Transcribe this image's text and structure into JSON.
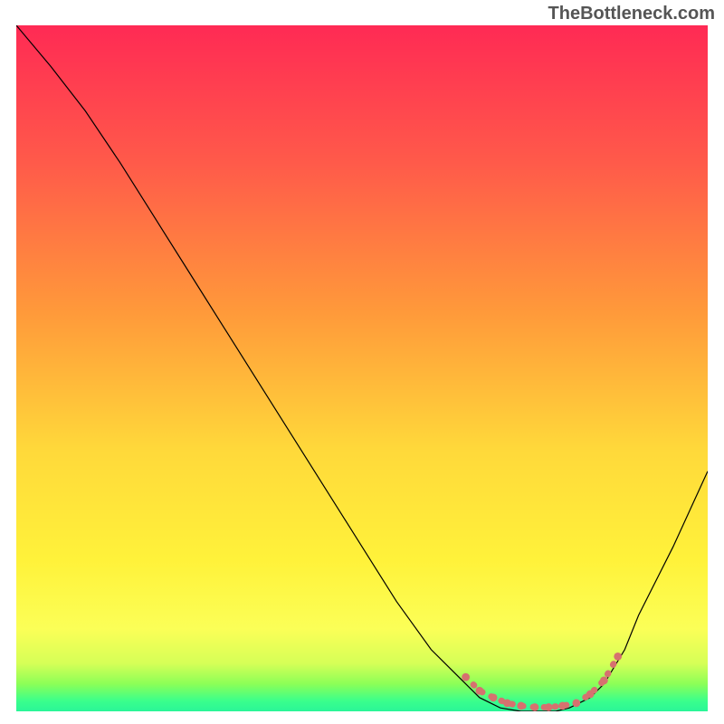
{
  "watermark": "TheBottleneck.com",
  "chart_data": {
    "type": "line",
    "title": "",
    "xlabel": "",
    "ylabel": "",
    "xlim": [
      0,
      100
    ],
    "ylim": [
      0,
      100
    ],
    "grid": false,
    "legend": false,
    "series": [
      {
        "name": "bottleneck-curve",
        "x": [
          0,
          5,
          10,
          15,
          20,
          25,
          30,
          35,
          40,
          45,
          50,
          55,
          60,
          65,
          67,
          70,
          73,
          75,
          78,
          80,
          83,
          85,
          88,
          90,
          95,
          100
        ],
        "y": [
          100,
          94,
          87.5,
          80,
          72,
          64,
          56,
          48,
          40,
          32,
          24,
          16,
          9,
          4,
          2,
          0.5,
          0,
          0,
          0,
          0.5,
          2,
          4,
          9,
          14,
          24,
          35
        ],
        "color": "#000000",
        "width": 1.2
      },
      {
        "name": "optimal-zone-marker",
        "x": [
          65,
          67,
          69,
          71,
          73,
          75,
          77,
          79,
          81,
          83,
          85,
          87
        ],
        "y": [
          5,
          3,
          2,
          1.2,
          0.8,
          0.6,
          0.6,
          0.8,
          1.2,
          2.5,
          4.5,
          8
        ],
        "color": "#d6716f",
        "width": 7,
        "dotted": true
      }
    ],
    "background_gradient": {
      "type": "vertical",
      "stops": [
        {
          "offset": 0,
          "color": "#ff2a54"
        },
        {
          "offset": 0.2,
          "color": "#ff5a4a"
        },
        {
          "offset": 0.42,
          "color": "#ff9a3a"
        },
        {
          "offset": 0.62,
          "color": "#ffd93a"
        },
        {
          "offset": 0.78,
          "color": "#fff23a"
        },
        {
          "offset": 0.88,
          "color": "#fbff57"
        },
        {
          "offset": 0.93,
          "color": "#d6ff57"
        },
        {
          "offset": 0.96,
          "color": "#8cff57"
        },
        {
          "offset": 0.985,
          "color": "#3aff8c"
        },
        {
          "offset": 1.0,
          "color": "#2af598"
        }
      ]
    }
  }
}
